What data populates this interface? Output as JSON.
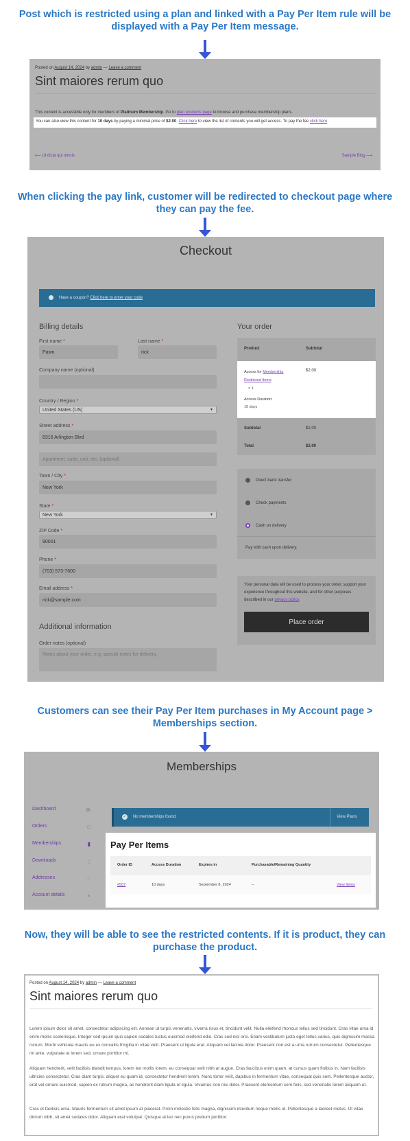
{
  "captions": {
    "c1": "Post which is restricted using a plan and linked with a Pay Per Item rule will be displayed with a Pay Per Item message.",
    "c2": "When clicking the pay link, customer will be redirected to checkout page where they can pay the fee.",
    "c3": "Customers can see their Pay Per Item purchases in My Account page > Memberships section.",
    "c4": "Now, they will be able to see the restricted contents. If it is product, they can purchase the product."
  },
  "post1": {
    "posted_on": "Posted on",
    "date": "August 14, 2024",
    "by": "by",
    "author": "admin",
    "sep": "—",
    "comment": "Leave a comment",
    "title": "Sint maiores rerum quo",
    "line1_a": "This content is accessible only for members of ",
    "line1_plan": "Platinum Membership",
    "line1_b": ". Go to ",
    "line1_link": "plan products page",
    "line1_c": " to browse and purchase membership plans.",
    "line2_a": "You can also view this content for ",
    "line2_days": "10 days",
    "line2_b": " by paying a minimal price of ",
    "line2_price": "$2.00",
    "line2_c": ". ",
    "line2_link1": "Click here",
    "line2_d": " to view the list of contents you will get access. To pay the fee ",
    "line2_link2": "click here",
    "prev": "⟵  Ut dicta qui omnis",
    "next": "Sample Blog  ⟶"
  },
  "checkout": {
    "title": "Checkout",
    "coupon_text": "Have a coupon?",
    "coupon_link": "Click here to enter your code",
    "billing_title": "Billing details",
    "first_name_label": "First name",
    "first_name": "Pawn",
    "last_name_label": "Last name",
    "last_name": "rick",
    "company_label": "Company name (optional)",
    "country_label": "Country / Region",
    "country": "United States (US)",
    "street_label": "Street address",
    "street": "8316 Arlington Blvd",
    "street2_placeholder": "Apartment, suite, unit, etc. (optional)",
    "town_label": "Town / City",
    "town": "New York",
    "state_label": "State",
    "state": "New York",
    "zip_label": "ZIP Code",
    "zip": "90001",
    "phone_label": "Phone",
    "phone": "(703) 573-7600",
    "email_label": "Email address",
    "email": "rick@sample.com",
    "additional_title": "Additional information",
    "notes_label": "Order notes (optional)",
    "notes_placeholder": "Notes about your order, e.g. special notes for delivery.",
    "order_title": "Your order",
    "col_product": "Product",
    "col_subtotal": "Subtotal",
    "item_a": "Access for ",
    "item_link1": "Membership",
    "item_link2": "Restricted Items",
    "item_qty": "× 1",
    "item_price": "$2.00",
    "duration_label": "Access Duration:",
    "duration": "10 days",
    "subtotal_label": "Subtotal",
    "subtotal": "$2.00",
    "total_label": "Total",
    "total": "$2.00",
    "pay1": "Direct bank transfer",
    "pay2": "Check payments",
    "pay3": "Cash on delivery",
    "pay_note": "Pay with cash upon delivery.",
    "privacy_a": "Your personal data will be used to process your order, support your experience throughout this website, and for other purposes described in our ",
    "privacy_link": "privacy policy",
    "privacy_b": ".",
    "place_order": "Place order",
    "req": "*"
  },
  "memberships": {
    "title": "Memberships",
    "nav": [
      "Dashboard",
      "Orders",
      "Memberships",
      "Downloads",
      "Addresses",
      "Account details"
    ],
    "notice": "No memberships found.",
    "view_plans": "View Plans",
    "ppi_title": "Pay Per Items",
    "cols": [
      "Order ID",
      "Access Duration",
      "Expires in",
      "Purchasable/Remaining Quantity"
    ],
    "row": {
      "order": "#507",
      "duration": "10 days",
      "expires": "September 8, 2024",
      "qty": "–",
      "action": "View Items"
    }
  },
  "post2": {
    "posted_on": "Posted on",
    "date": "August 14, 2024",
    "by": "by",
    "author": "admin",
    "sep": "—",
    "comment": "Leave a comment",
    "title": "Sint maiores rerum quo",
    "p1": "Lorem ipsum dolor sit amet, consectetur adipiscing elit. Aenean ut turpis venenatis, viverra risus et, tincidunt velit. Nulla eleifend rhoncus tellus sed tincidunt. Cras vitae urna id enim mollis scelerisque. Integer sed ipsum quis sapien sodales luctus euismod eleifend odio. Cras sed nisl orci. Etiam vestibulum justo eget tellus varius, quis dignissim massa rutrum. Morbi vehicula mauris eu ex convallis fringilla in vitae velit. Praesent ut ligula erat. Aliquam vel lacinia dolor. Praesent non est a urna rutrum consectetur. Pellentesque mi ante, vulputate at lorem sed, ornare porttitor mi.",
    "p2": "Aliquam hendrerit, velit facilisis blandit tempus, lorem leo mollis lorem, eu consequat velit nibh at augue. Cras faucibus enim quam, at cursus quam finibus in. Nam facilisis ultricies consectetur. Cras diam turpis, aliquet eu quam id, consectetur hendrerit lorem. Nunc tortor velit, dapibus in fermentum vitae, consequat quis sem. Pellentesque auctor, erat vel ornare euismod, sapien ex rutrum magna, ac hendrerit diam ligula et ligula. Vivamus non nisi dolor. Praesent elementum sem felis, sed venenatis lorem aliquam ut.",
    "p3": "Cras et facilisis urna. Mauris fermentum sit amet ipsum at placerat. Proin molestie felis magna, dignissim interdum neque mollis id. Pellentesque a laoreet metus. Ut vitae dictum nibh, sit amet sodales dolor. Aliquam erat volutpat. Quisque at leo nec purus pretium porttitor."
  }
}
